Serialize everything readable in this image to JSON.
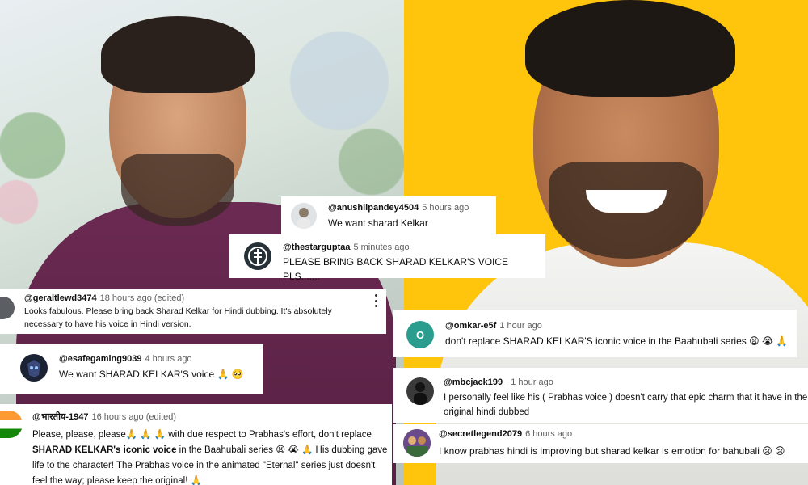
{
  "comments": [
    {
      "id": "anushilpandey",
      "handle": "@anushilpandey4504",
      "time": "5 hours ago",
      "text": "We want sharad Kelkar",
      "avatar_color": "#dfe3e6"
    },
    {
      "id": "thestarguptaa",
      "handle": "@thestarguptaa",
      "time": "5 minutes ago",
      "text": "PLEASE BRING BACK SHARAD KELKAR'S VOICE PLS.......",
      "avatar_color": "#263238"
    },
    {
      "id": "geraltlewd",
      "handle": "@geraltlewd3474",
      "time": "18 hours ago (edited)",
      "text": "Looks fabulous. Please bring back Sharad Kelkar for Hindi dubbing. It's absolutely necessary to have his voice in Hindi version.",
      "avatar_color": "#5b5f63"
    },
    {
      "id": "esafegaming",
      "handle": "@esafegaming9039",
      "time": "4 hours ago",
      "text": "We want SHARAD KELKAR'S voice 🙏 🥺",
      "avatar_color": "#1b2233"
    },
    {
      "id": "bharatiya",
      "handle": "@भारतीय-1947",
      "time": "16 hours ago (edited)",
      "text_parts": [
        "Please, please, please🙏 🙏 🙏  with due respect to Prabhas's effort, don't replace ",
        "SHARAD KELKAR's iconic voice",
        " in the Baahubali series 😫 😭 🙏 His dubbing gave life to the character! The Prabhas voice in the animated \"Eternal\" series just doesn't feel the way; please keep the original! 🙏"
      ],
      "avatar_color": "#ff9933"
    },
    {
      "id": "omkar",
      "handle": "@omkar-e5f",
      "time": "1 hour ago",
      "text": "don't replace SHARAD KELKAR'S iconic voice in the Baahubali series 😫 😭 🙏",
      "avatar_letter": "O",
      "avatar_color": "#2a9d8f"
    },
    {
      "id": "mbcjack",
      "handle": "@mbcjack199_",
      "time": "1 hour ago",
      "text": "I personally feel like his ( Prabhas voice ) doesn't carry that epic charm that it have in the original hindi dubbed",
      "avatar_color": "#3a3a3a"
    },
    {
      "id": "secretlegend",
      "handle": "@secretlegend2079",
      "time": "6 hours ago",
      "text": "I know prabhas hindi is improving but sharad kelkar is emotion for bahubali 😢 😢",
      "avatar_color": "#6a4a8a"
    }
  ]
}
